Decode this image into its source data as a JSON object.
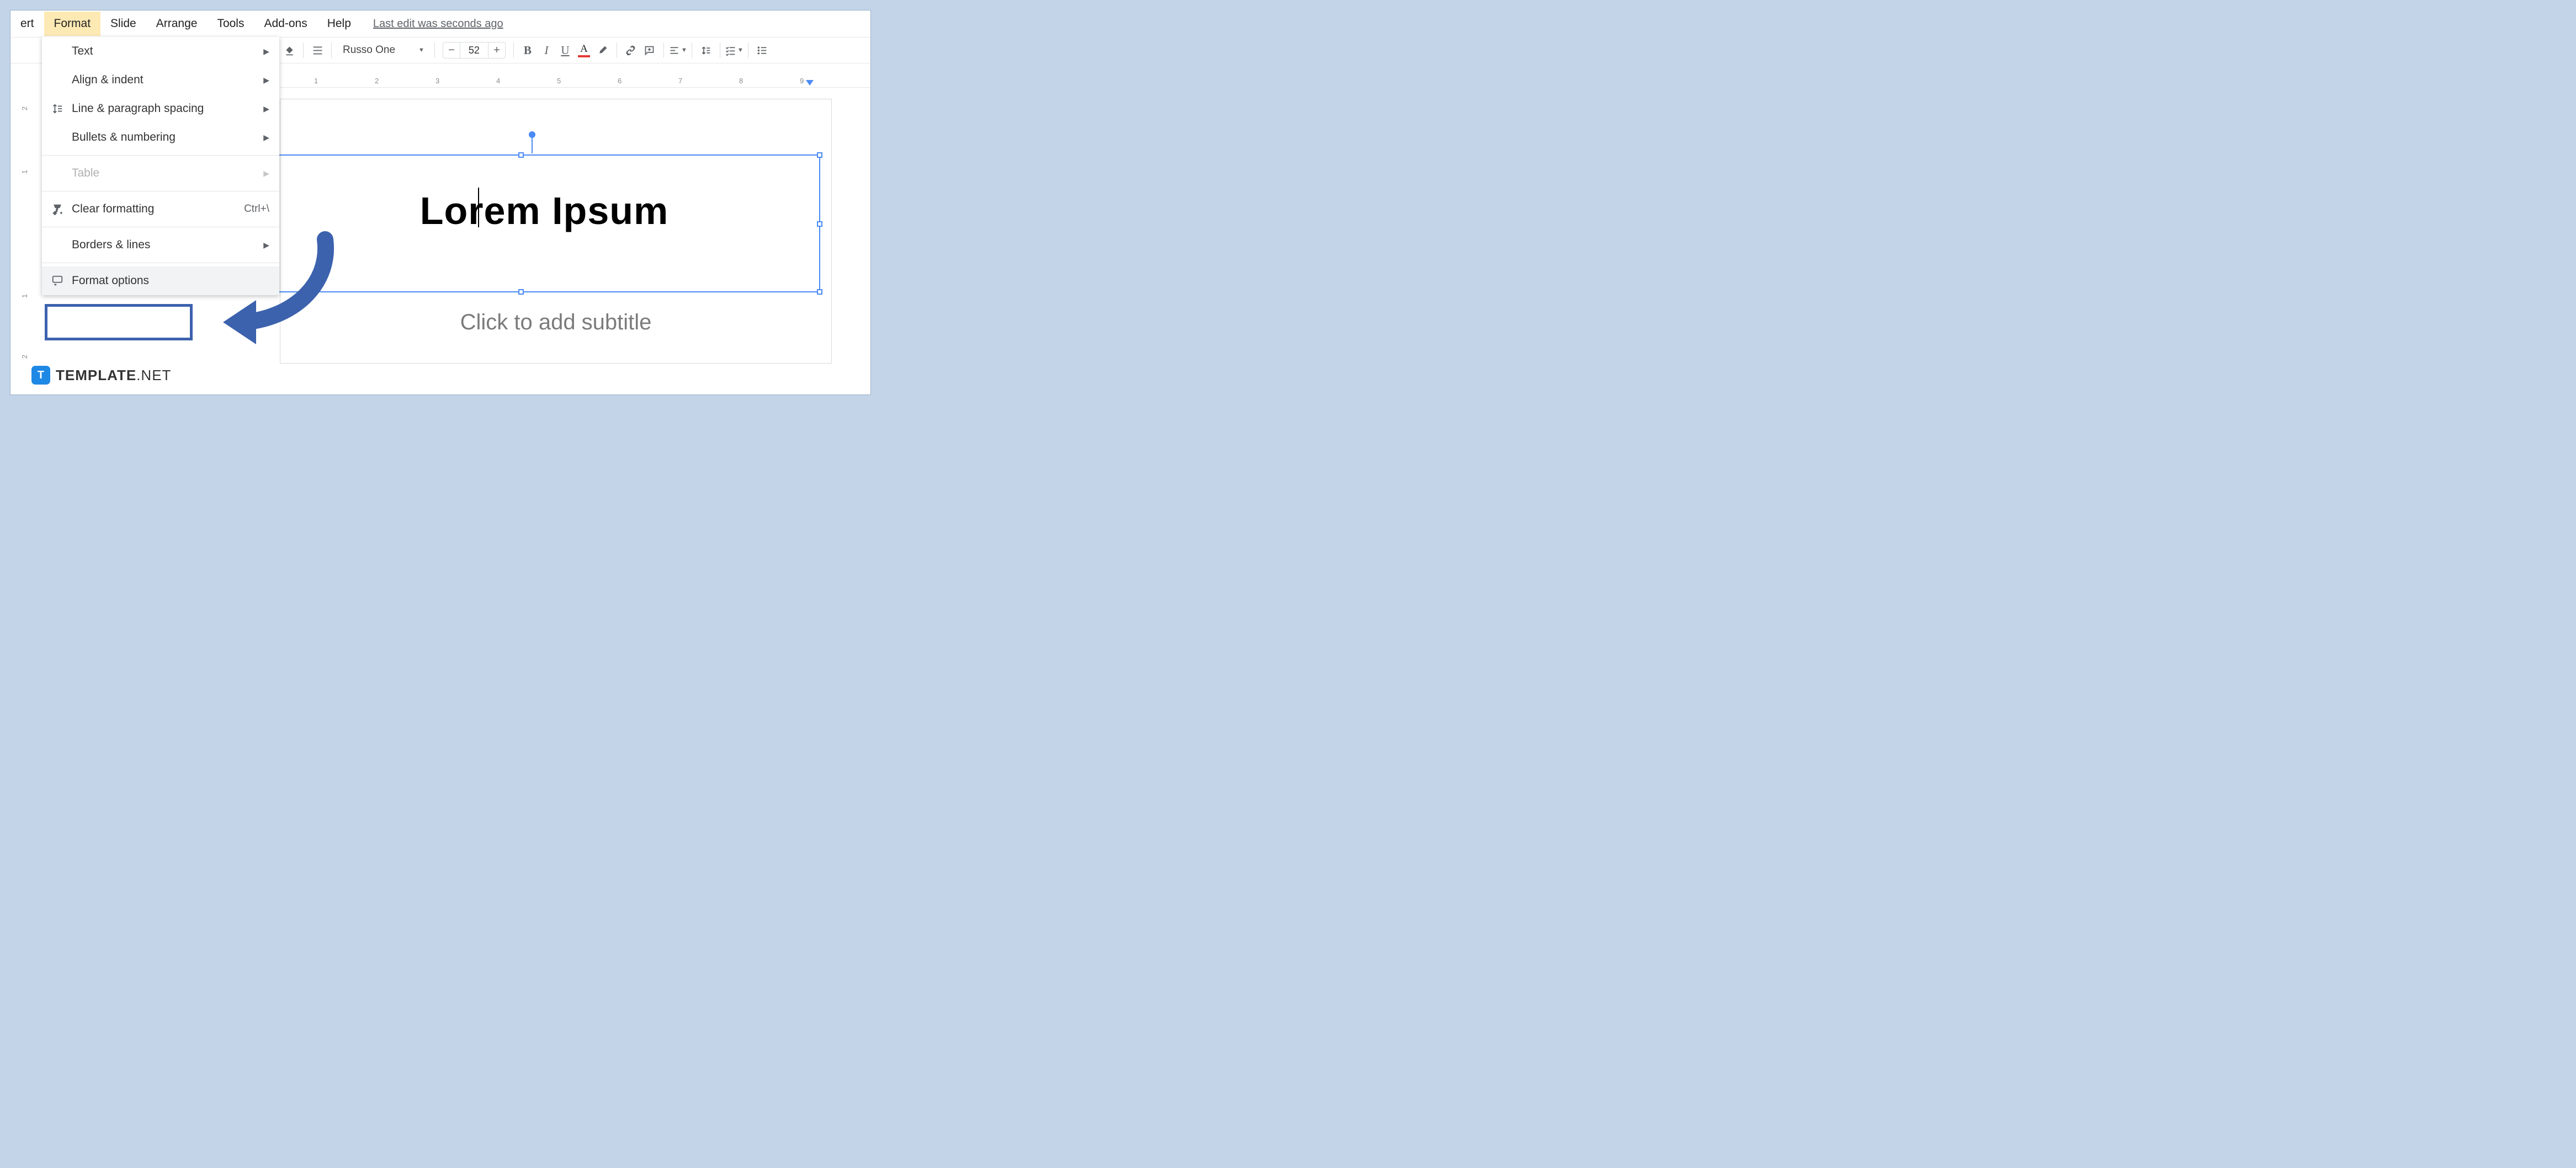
{
  "menubar": {
    "items": [
      "ert",
      "Format",
      "Slide",
      "Arrange",
      "Tools",
      "Add-ons",
      "Help"
    ],
    "active_index": 1,
    "edit_status": "Last edit was seconds ago"
  },
  "toolbar": {
    "font_name": "Russo One",
    "font_size": "52"
  },
  "dropdown": {
    "items": [
      {
        "label": "Text",
        "submenu": true,
        "icon": null
      },
      {
        "label": "Align & indent",
        "submenu": true,
        "icon": null
      },
      {
        "label": "Line & paragraph spacing",
        "submenu": true,
        "icon": "line-spacing"
      },
      {
        "label": "Bullets & numbering",
        "submenu": true,
        "icon": null
      }
    ],
    "table": {
      "label": "Table",
      "submenu": true,
      "disabled": true
    },
    "clear": {
      "label": "Clear formatting",
      "shortcut": "Ctrl+\\",
      "icon": "clear-format"
    },
    "borders": {
      "label": "Borders & lines",
      "submenu": true
    },
    "format_options": {
      "label": "Format options",
      "icon": "format-options"
    }
  },
  "canvas": {
    "title": "Lorem Ipsum",
    "subtitle_placeholder": "Click to add subtitle"
  },
  "ruler": {
    "numbers": [
      "1",
      "2",
      "3",
      "4",
      "5",
      "6",
      "7",
      "8",
      "9"
    ]
  },
  "ruler_v": {
    "numbers": [
      "2",
      "1",
      "1",
      "2"
    ]
  },
  "footer": {
    "brand_bold": "TEMPLATE",
    "brand_light": ".NET",
    "badge": "T"
  }
}
